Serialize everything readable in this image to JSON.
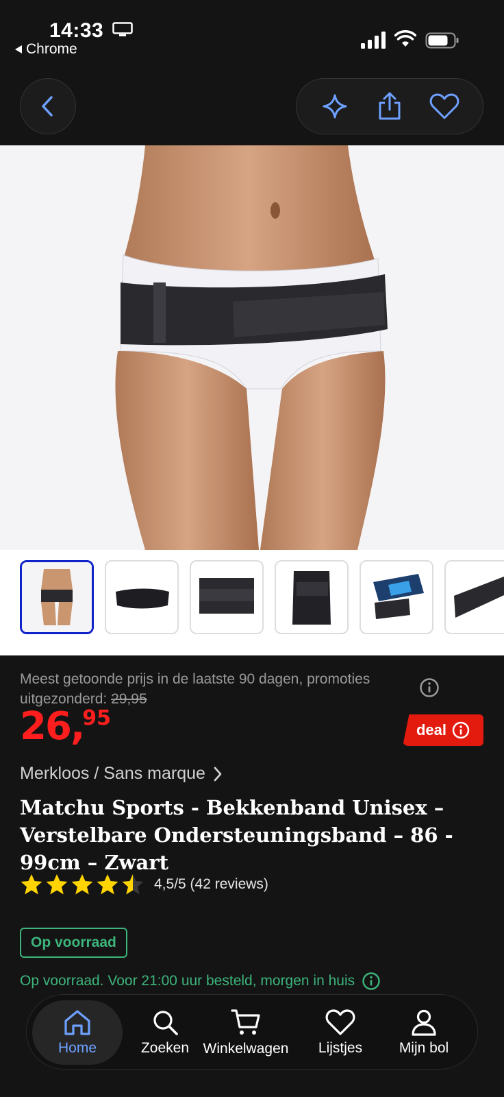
{
  "status_bar": {
    "time": "14:33",
    "back_app": "Chrome"
  },
  "top_nav": {
    "back_icon": "chevron-left-icon",
    "actions": [
      "sparkle-icon",
      "share-icon",
      "heart-icon"
    ]
  },
  "gallery": {
    "thumbnail_count": 6,
    "active_index": 0
  },
  "product": {
    "price_note_prefix": "Meest getoonde prijs in de laatste 90 dagen, promoties uitgezonderd:",
    "price_note_old": "29,95",
    "price_int": "26",
    "price_comma": ",",
    "price_cents": "95",
    "deal_label": "deal",
    "brand": "Merkloos / Sans marque",
    "title": "Matchu Sports - Bekkenband Unisex – Verstelbare Ondersteuningsband – 86 - 99cm – Zwart",
    "rating_value": 4.5,
    "rating_text": "4,5/5 (42 reviews)",
    "stock_badge": "Op voorraad",
    "delivery_text": "Op voorraad. Voor 21:00 uur besteld, morgen in huis"
  },
  "tabbar": {
    "tabs": [
      {
        "label": "Home",
        "icon": "home-icon"
      },
      {
        "label": "Zoeken",
        "icon": "search-icon"
      },
      {
        "label": "Winkelwagen",
        "icon": "cart-icon"
      },
      {
        "label": "Lijstjes",
        "icon": "heart-icon"
      },
      {
        "label": "Mijn bol",
        "icon": "user-icon"
      }
    ]
  },
  "colors": {
    "accent_blue": "#6ea1ff",
    "price_red": "#ff1e1e",
    "stock_green": "#3db57c",
    "deal_red": "#e31b0e"
  }
}
